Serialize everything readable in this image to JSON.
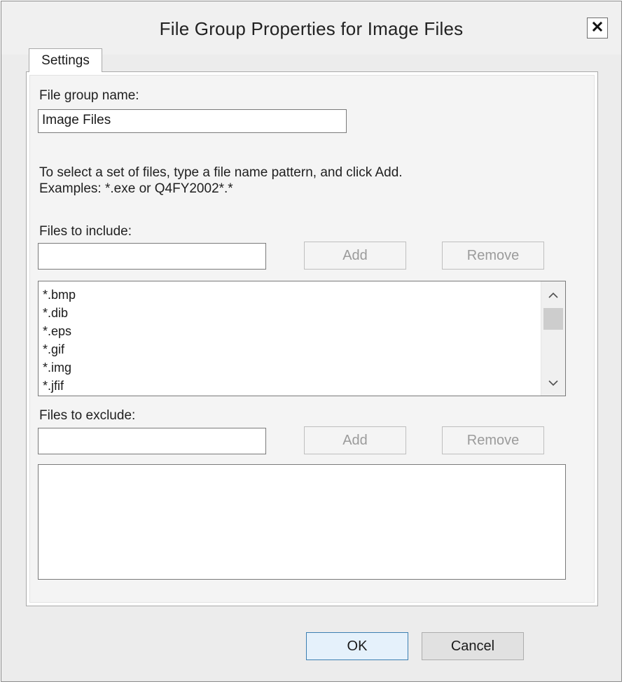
{
  "window": {
    "title": "File Group Properties for Image Files",
    "close_glyph": "✕"
  },
  "tabs": [
    {
      "label": "Settings",
      "selected": true
    }
  ],
  "settings": {
    "group_name_label": "File group name:",
    "group_name_value": "Image Files",
    "instructions_line1": "To select a set of files, type a file name pattern, and click Add.",
    "instructions_line2": "Examples: *.exe or Q4FY2002*.*",
    "include": {
      "label": "Files to include:",
      "input_value": "",
      "add_label": "Add",
      "remove_label": "Remove",
      "items": [
        "*.bmp",
        "*.dib",
        "*.eps",
        "*.gif",
        "*.img",
        "*.jfif"
      ]
    },
    "exclude": {
      "label": "Files to exclude:",
      "input_value": "",
      "add_label": "Add",
      "remove_label": "Remove",
      "items": []
    }
  },
  "footer": {
    "ok_label": "OK",
    "cancel_label": "Cancel"
  },
  "icons": {
    "close": "close-icon",
    "scroll_up": "chevron-up-icon",
    "scroll_down": "chevron-down-icon"
  },
  "colors": {
    "ok_border": "#3c7fb1",
    "ok_background": "#e5f1fb",
    "disabled_text": "#9b9b9b"
  }
}
